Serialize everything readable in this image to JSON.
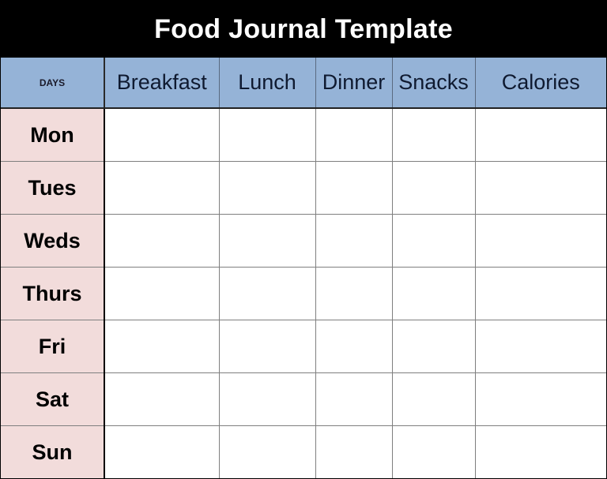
{
  "title": "Food Journal Template",
  "columns": {
    "days": "DAYS",
    "meals": [
      "Breakfast",
      "Lunch",
      "Dinner",
      "Snacks",
      "Calories"
    ]
  },
  "rows": [
    {
      "day": "Mon",
      "cells": [
        "",
        "",
        "",
        "",
        ""
      ]
    },
    {
      "day": "Tues",
      "cells": [
        "",
        "",
        "",
        "",
        ""
      ]
    },
    {
      "day": "Weds",
      "cells": [
        "",
        "",
        "",
        "",
        ""
      ]
    },
    {
      "day": "Thurs",
      "cells": [
        "",
        "",
        "",
        "",
        ""
      ]
    },
    {
      "day": "Fri",
      "cells": [
        "",
        "",
        "",
        "",
        ""
      ]
    },
    {
      "day": "Sat",
      "cells": [
        "",
        "",
        "",
        "",
        ""
      ]
    },
    {
      "day": "Sun",
      "cells": [
        "",
        "",
        "",
        "",
        ""
      ]
    }
  ],
  "colors": {
    "title_bg": "#000000",
    "header_bg": "#95b3d7",
    "day_bg": "#f2dcdb"
  }
}
